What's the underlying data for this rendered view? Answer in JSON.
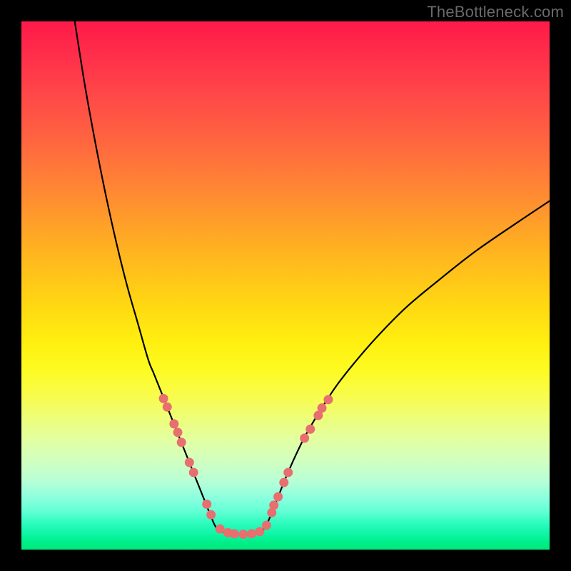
{
  "watermark": "TheBottleneck.com",
  "chart_data": {
    "type": "line",
    "title": "",
    "xlabel": "",
    "ylabel": "",
    "xlim": [
      0,
      100
    ],
    "ylim": [
      0,
      100
    ],
    "grid": false,
    "series": [
      {
        "name": "left-curve",
        "x": [
          10.1,
          12,
          14,
          16,
          18,
          20,
          22,
          24,
          25,
          26,
          27,
          28,
          29,
          30,
          31,
          32,
          33,
          34,
          35,
          36,
          37
        ],
        "y": [
          100,
          88,
          77,
          67,
          58,
          50,
          43,
          36,
          33.5,
          31,
          28.5,
          26,
          23.5,
          21,
          18.5,
          16,
          13.5,
          11,
          8.5,
          6,
          4
        ]
      },
      {
        "name": "right-curve",
        "x": [
          46,
          47,
          48,
          49,
          50,
          52,
          54,
          57,
          60,
          64,
          68,
          73,
          79,
          86,
          94,
          100
        ],
        "y": [
          4,
          6,
          8.5,
          11,
          13.5,
          18,
          22,
          27,
          31.5,
          36.5,
          41,
          46,
          51,
          56.5,
          62,
          66
        ]
      },
      {
        "name": "valley-floor",
        "x": [
          37,
          38.5,
          40,
          41.5,
          43,
          44.5,
          46
        ],
        "y": [
          4,
          3.2,
          3,
          2.9,
          3,
          3.2,
          4
        ]
      }
    ],
    "markers_left": [
      {
        "x": 26.9,
        "y": 28.6
      },
      {
        "x": 27.6,
        "y": 27.0
      },
      {
        "x": 28.9,
        "y": 23.8
      },
      {
        "x": 29.6,
        "y": 22.2
      },
      {
        "x": 30.3,
        "y": 20.3
      },
      {
        "x": 31.8,
        "y": 16.5
      },
      {
        "x": 32.6,
        "y": 14.6
      },
      {
        "x": 35.1,
        "y": 8.6
      },
      {
        "x": 35.9,
        "y": 6.6
      },
      {
        "x": 37.6,
        "y": 3.9
      }
    ],
    "markers_right": [
      {
        "x": 46.4,
        "y": 4.6
      },
      {
        "x": 47.4,
        "y": 7.0
      },
      {
        "x": 47.8,
        "y": 8.4
      },
      {
        "x": 48.6,
        "y": 10.0
      },
      {
        "x": 49.7,
        "y": 12.7
      },
      {
        "x": 50.5,
        "y": 14.6
      },
      {
        "x": 53.6,
        "y": 21.1
      },
      {
        "x": 54.7,
        "y": 22.8
      },
      {
        "x": 56.2,
        "y": 25.4
      },
      {
        "x": 56.9,
        "y": 26.8
      },
      {
        "x": 58.1,
        "y": 28.4
      }
    ],
    "markers_floor": [
      {
        "x": 39.1,
        "y": 3.2
      },
      {
        "x": 40.3,
        "y": 3.0
      },
      {
        "x": 42.0,
        "y": 2.9
      },
      {
        "x": 43.6,
        "y": 3.0
      },
      {
        "x": 45.1,
        "y": 3.4
      }
    ],
    "marker_color": "#e76f6f",
    "curve_stroke": "#000000",
    "curve_width": 2.2
  }
}
